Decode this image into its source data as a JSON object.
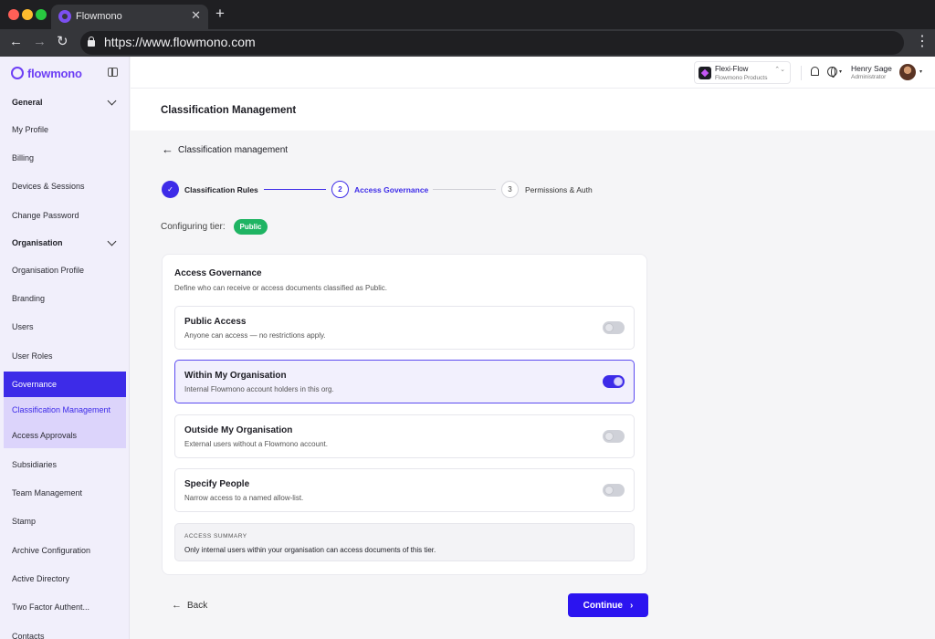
{
  "browser": {
    "tab_title": "Flowmono",
    "tab_close": "✕",
    "new_tab": "+",
    "url": "https://www.flowmono.com",
    "back": "←",
    "forward": "→",
    "reload": "↻",
    "menu": "⋮"
  },
  "sidebar": {
    "logo_text": "flowmono",
    "items": [
      {
        "label": "General"
      },
      {
        "label": "My Profile"
      },
      {
        "label": "Billing"
      },
      {
        "label": "Devices & Sessions"
      },
      {
        "label": "Change Password"
      },
      {
        "label": "Organisation"
      },
      {
        "label": "Organisation Profile"
      },
      {
        "label": "Branding"
      },
      {
        "label": "Users"
      },
      {
        "label": "User Roles"
      },
      {
        "label": "Governance"
      },
      {
        "label": "Classification Management"
      },
      {
        "label": "Access Approvals"
      },
      {
        "label": "Subsidiaries"
      },
      {
        "label": "Team Management"
      },
      {
        "label": "Stamp"
      },
      {
        "label": "Archive Configuration"
      },
      {
        "label": "Active Directory"
      },
      {
        "label": "Two Factor Authent..."
      },
      {
        "label": "Contacts"
      }
    ]
  },
  "header": {
    "workspace_name": "Flexi-Flow",
    "workspace_sub": "Flowmono Products",
    "workspace_chevron": "⌃⌄",
    "user_name": "Henry Sage",
    "user_role": "Administrator",
    "caret": "▾"
  },
  "page": {
    "title": "Classification Management",
    "back_link": "Classification management",
    "back_arrow": "←"
  },
  "stepper": {
    "steps": [
      {
        "number": "✓",
        "label": "Classification Rules",
        "state": "complete"
      },
      {
        "number": "2",
        "label": "Access Governance",
        "state": "active"
      },
      {
        "number": "3",
        "label": "Permissions & Auth",
        "state": "pending"
      }
    ]
  },
  "tier": {
    "label": "Configuring tier:",
    "badge": "Public",
    "badge_color": "#1fb463"
  },
  "card": {
    "title": "Access Governance",
    "description": "Define who can receive or access documents classified as Public.",
    "options": [
      {
        "title": "Public Access",
        "description": "Anyone can access — no restrictions apply.",
        "enabled": false
      },
      {
        "title": "Within My Organisation",
        "description": "Internal Flowmono account holders in this org.",
        "enabled": true
      },
      {
        "title": "Outside My Organisation",
        "description": "External users without a Flowmono account.",
        "enabled": false
      },
      {
        "title": "Specify People",
        "description": "Narrow access to a named allow-list.",
        "enabled": false
      }
    ],
    "summary_label": "ACCESS SUMMARY",
    "summary_text": "Only internal users within your organisation can access documents of this tier."
  },
  "footer": {
    "back_label": "Back",
    "back_arrow": "←",
    "continue_label": "Continue",
    "continue_chevron": "›"
  },
  "colors": {
    "accent": "#3d2be8",
    "primary_button": "#2b14f0",
    "sidebar_bg": "#f1effb"
  }
}
